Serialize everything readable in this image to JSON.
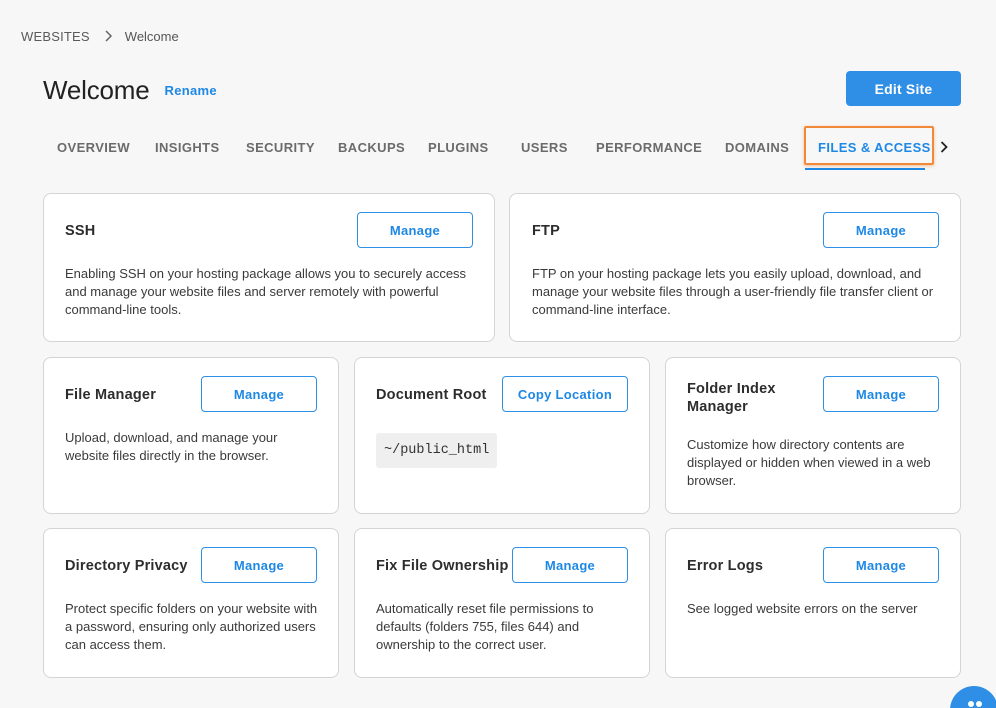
{
  "breadcrumb": {
    "root": "WEBSITES",
    "current": "Welcome"
  },
  "header": {
    "title": "Welcome",
    "rename_label": "Rename",
    "edit_site_label": "Edit Site"
  },
  "tabs": [
    {
      "label": "OVERVIEW"
    },
    {
      "label": "INSIGHTS"
    },
    {
      "label": "SECURITY"
    },
    {
      "label": "BACKUPS"
    },
    {
      "label": "PLUGINS"
    },
    {
      "label": "USERS"
    },
    {
      "label": "PERFORMANCE"
    },
    {
      "label": "DOMAINS"
    },
    {
      "label": "FILES & ACCESS",
      "active": true
    }
  ],
  "cards": {
    "ssh": {
      "title": "SSH",
      "button": "Manage",
      "description": "Enabling SSH on your hosting package allows you to securely access and manage your website files and server remotely with powerful command-line tools."
    },
    "ftp": {
      "title": "FTP",
      "button": "Manage",
      "description": "FTP on your hosting package lets you easily upload, download, and manage your website files through a user-friendly file transfer client or command-line interface."
    },
    "file_manager": {
      "title": "File Manager",
      "button": "Manage",
      "description": "Upload, download, and manage your website files directly in the browser."
    },
    "document_root": {
      "title": "Document Root",
      "button": "Copy Location",
      "path": "~/public_html"
    },
    "folder_index": {
      "title": "Folder Index Manager",
      "button": "Manage",
      "description": "Customize how directory contents are displayed or hidden when viewed in a web browser."
    },
    "directory_privacy": {
      "title": "Directory Privacy",
      "button": "Manage",
      "description": "Protect specific folders on your website with a password, ensuring only authorized users can access them."
    },
    "fix_ownership": {
      "title": "Fix File Ownership",
      "button": "Manage",
      "description": "Automatically reset file permissions to defaults (folders 755, files 644) and ownership to the correct user."
    },
    "error_logs": {
      "title": "Error Logs",
      "button": "Manage",
      "description": "See logged website errors on the server"
    }
  },
  "icons": {
    "breadcrumb_separator": "chevron-right-icon",
    "tabs_next": "chevron-right-icon",
    "chat": "chat-icon"
  },
  "colors": {
    "accent": "#2f8fe6",
    "active_tab_highlight": "#f08a3a",
    "background": "#f7f7f7"
  }
}
